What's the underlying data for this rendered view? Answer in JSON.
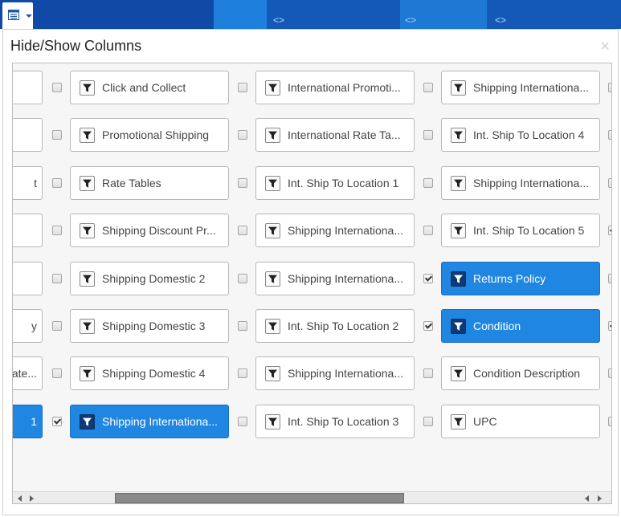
{
  "toolbar": {
    "menu_icon": "table-list-icon",
    "caret_icon": "caret-down-icon",
    "code_glyph": "<>"
  },
  "modal": {
    "title": "Hide/Show Columns",
    "close_label": "×"
  },
  "colors": {
    "selected_bg": "#1f86e2",
    "header_blue": "#1149a6"
  },
  "partial_col": [
    {
      "label": "",
      "selected": false
    },
    {
      "label": "",
      "selected": false
    },
    {
      "label": "t",
      "selected": false
    },
    {
      "label": "",
      "selected": false
    },
    {
      "label": "",
      "selected": false
    },
    {
      "label": "y",
      "selected": false
    },
    {
      "label": "ate...",
      "selected": false
    },
    {
      "label": "1",
      "selected": true
    }
  ],
  "columns": [
    {
      "checked": false,
      "label": "Click and Collect",
      "selected": false
    },
    {
      "checked": false,
      "label": "Promotional Shipping",
      "selected": false
    },
    {
      "checked": false,
      "label": "Rate Tables",
      "selected": false
    },
    {
      "checked": false,
      "label": "Shipping Discount Pr...",
      "selected": false
    },
    {
      "checked": false,
      "label": "Shipping Domestic 2",
      "selected": false
    },
    {
      "checked": false,
      "label": "Shipping Domestic 3",
      "selected": false
    },
    {
      "checked": false,
      "label": "Shipping Domestic 4",
      "selected": false
    },
    {
      "checked": true,
      "label": "Shipping Internationa...",
      "selected": true
    },
    {
      "checked": false,
      "label": "International Promoti...",
      "selected": false
    },
    {
      "checked": false,
      "label": "International Rate Ta...",
      "selected": false
    },
    {
      "checked": false,
      "label": "Int. Ship To Location 1",
      "selected": false
    },
    {
      "checked": false,
      "label": "Shipping Internationa...",
      "selected": false
    },
    {
      "checked": false,
      "label": "Shipping Internationa...",
      "selected": false
    },
    {
      "checked": false,
      "label": "Int. Ship To Location 2",
      "selected": false
    },
    {
      "checked": false,
      "label": "Shipping Internationa...",
      "selected": false
    },
    {
      "checked": false,
      "label": "Int. Ship To Location 3",
      "selected": false
    },
    {
      "checked": false,
      "label": "Shipping Internationa...",
      "selected": false
    },
    {
      "checked": false,
      "label": "Int. Ship To Location 4",
      "selected": false
    },
    {
      "checked": false,
      "label": "Shipping Internationa...",
      "selected": false
    },
    {
      "checked": false,
      "label": "Int. Ship To Location 5",
      "selected": false
    },
    {
      "checked": true,
      "label": "Returns Policy",
      "selected": true
    },
    {
      "checked": true,
      "label": "Condition",
      "selected": true
    },
    {
      "checked": false,
      "label": "Condition Description",
      "selected": false
    },
    {
      "checked": false,
      "label": "UPC",
      "selected": false
    }
  ],
  "edge_checkboxes": [
    false,
    false,
    false,
    true,
    false,
    true,
    false,
    false
  ],
  "hscroll": {
    "thumb_fraction": 0.5
  }
}
